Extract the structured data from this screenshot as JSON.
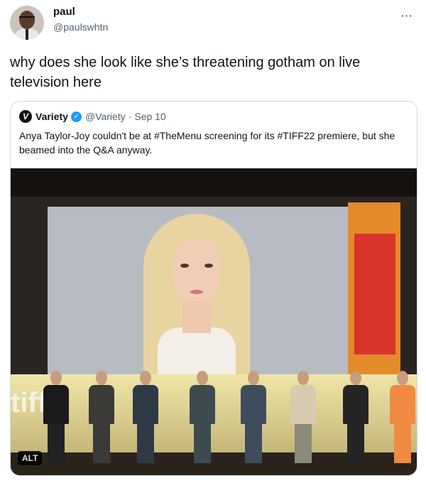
{
  "tweet": {
    "author_name": "paul",
    "author_handle": "@paulswhtn",
    "more_icon": "···",
    "text": "why does she look like she’s threatening gotham on live television here"
  },
  "quoted_tweet": {
    "logo_letter": "V",
    "author_name": "Variety",
    "verified_icon": "✓",
    "author_handle": "@Variety",
    "separator": "·",
    "date": "Sep 10",
    "text": "Anya Taylor-Joy couldn't be at #TheMenu screening for its #TIFF22 premiere, but she beamed into the Q&A anyway.",
    "media": {
      "alt_badge": "ALT",
      "stage_text": "tiff"
    }
  },
  "colors": {
    "text": "#0f1419",
    "secondary": "#536471",
    "border": "#cfd9de",
    "verified": "#1d9bf0"
  },
  "people": [
    {
      "body": "#1a1a1a",
      "legs": "#222222"
    },
    {
      "body": "#3b3a36",
      "legs": "#3b3a36"
    },
    {
      "body": "#2e3a46",
      "legs": "#2e3a46"
    },
    {
      "body": "#3d4b4f",
      "legs": "#3d4b4f"
    },
    {
      "body": "#3e4c5c",
      "legs": "#3e4c5c"
    },
    {
      "body": "#d8ccb0",
      "legs": "#8a8a7a"
    },
    {
      "body": "#252525",
      "legs": "#252525"
    },
    {
      "body": "#f08a40",
      "legs": "#f08a40"
    }
  ]
}
